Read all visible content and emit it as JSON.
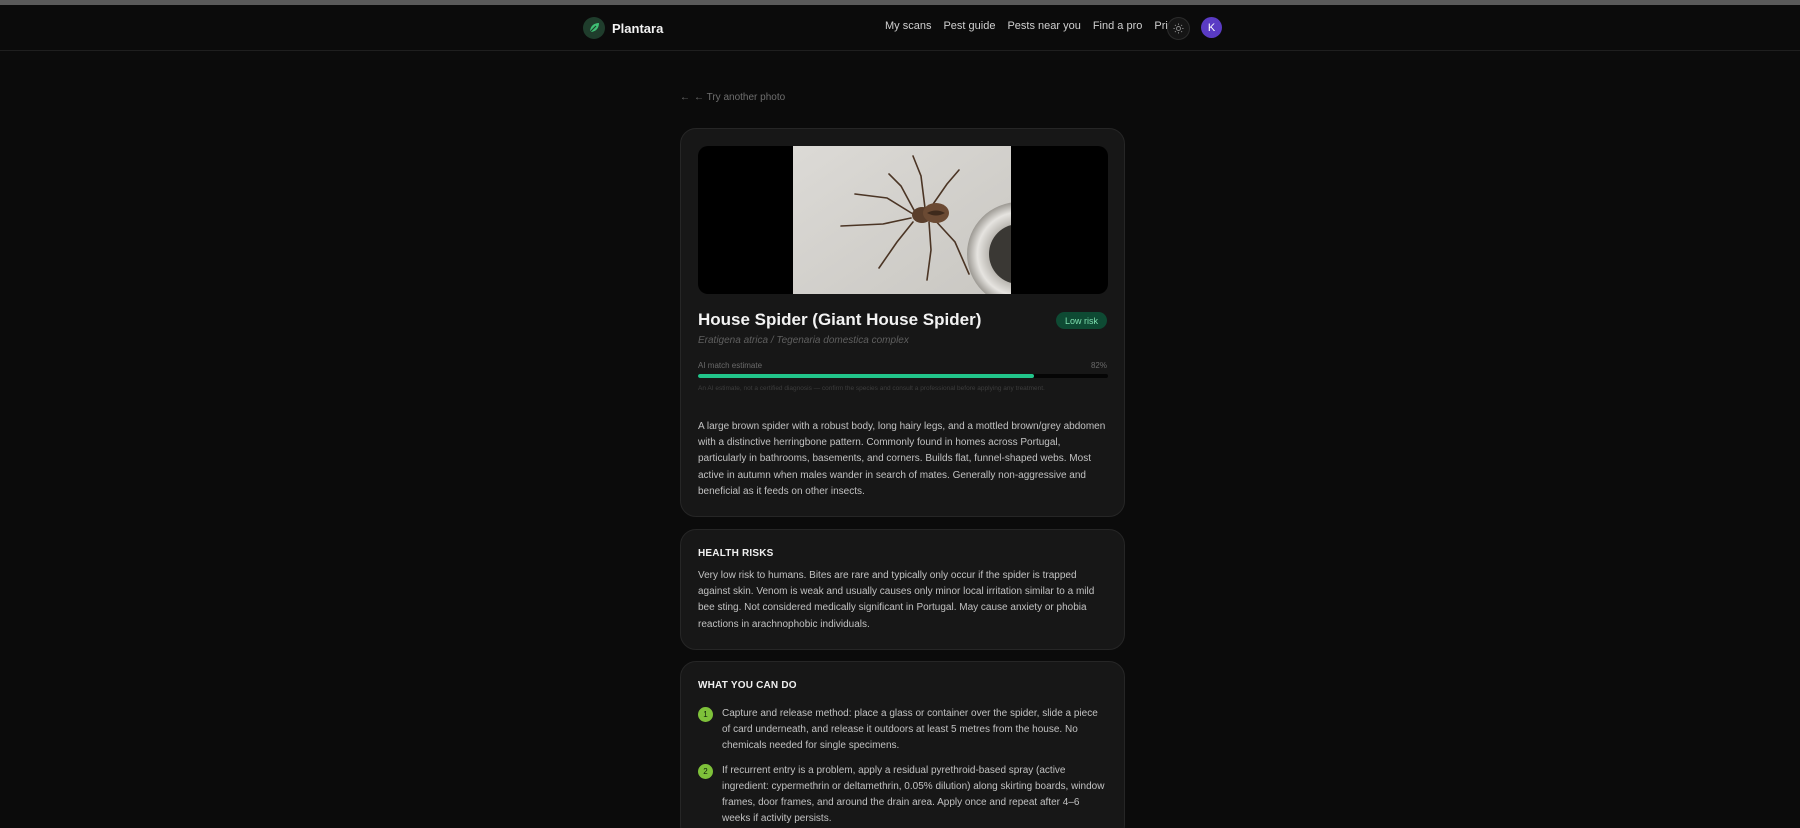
{
  "nav": {
    "brand": "Plantara",
    "links": [
      "My scans",
      "Pest guide",
      "Pests near you",
      "Find a pro",
      "Pricing"
    ],
    "avatar_initial": "K",
    "theme_icon": "sun-icon"
  },
  "back_link": "← Try another photo",
  "result": {
    "image_alt": "Photo of a brown spider on a white surface next to a drain",
    "title": "House Spider (Giant House Spider)",
    "risk_badge": "Low risk",
    "scientific_name": "Eratigena atrica / Tegenaria domestica complex",
    "match_label": "AI match estimate",
    "match_percent_text": "82%",
    "match_fraction": 0.82,
    "disclaimer": "An AI estimate, not a certified diagnosis — confirm the species and consult a professional before applying any treatment.",
    "description": "A large brown spider with a robust body, long hairy legs, and a mottled brown/grey abdomen with a distinctive herringbone pattern. Commonly found in homes across Portugal, particularly in bathrooms, basements, and corners. Builds flat, funnel-shaped webs. Most active in autumn when males wander in search of mates. Generally non-aggressive and beneficial as it feeds on other insects."
  },
  "health": {
    "title": "HEALTH RISKS",
    "body": "Very low risk to humans. Bites are rare and typically only occur if the spider is trapped against skin. Venom is weak and usually causes only minor local irritation similar to a mild bee sting. Not considered medically significant in Portugal. May cause anxiety or phobia reactions in arachnophobic individuals."
  },
  "todo": {
    "title": "WHAT YOU CAN DO",
    "steps": [
      {
        "num": "1",
        "text": "Capture and release method: place a glass or container over the spider, slide a piece of card underneath, and release it outdoors at least 5 metres from the house. No chemicals needed for single specimens."
      },
      {
        "num": "2",
        "text": "If recurrent entry is a problem, apply a residual pyrethroid-based spray (active ingredient: cypermethrin or deltamethrin, 0.05% dilution) along skirting boards, window frames, door frames, and around the drain area. Apply once and repeat after 4–6 weeks if activity persists."
      }
    ]
  },
  "colors": {
    "background": "#0b0b0b",
    "card": "#171717",
    "accent_green": "#22c58b",
    "step_badge": "#7ec13a",
    "risk_badge_bg": "#0e4a33",
    "avatar": "#5a3bc4"
  }
}
